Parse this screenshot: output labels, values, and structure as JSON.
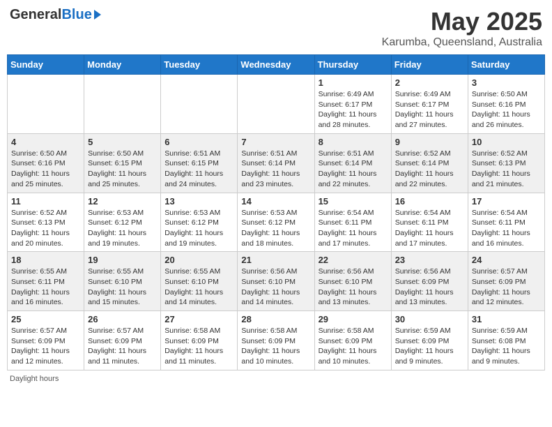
{
  "logo": {
    "general": "General",
    "blue": "Blue"
  },
  "title": "May 2025",
  "location": "Karumba, Queensland, Australia",
  "days_of_week": [
    "Sunday",
    "Monday",
    "Tuesday",
    "Wednesday",
    "Thursday",
    "Friday",
    "Saturday"
  ],
  "weeks": [
    [
      {
        "day": "",
        "info": ""
      },
      {
        "day": "",
        "info": ""
      },
      {
        "day": "",
        "info": ""
      },
      {
        "day": "",
        "info": ""
      },
      {
        "day": "1",
        "info": "Sunrise: 6:49 AM\nSunset: 6:17 PM\nDaylight: 11 hours and 28 minutes."
      },
      {
        "day": "2",
        "info": "Sunrise: 6:49 AM\nSunset: 6:17 PM\nDaylight: 11 hours and 27 minutes."
      },
      {
        "day": "3",
        "info": "Sunrise: 6:50 AM\nSunset: 6:16 PM\nDaylight: 11 hours and 26 minutes."
      }
    ],
    [
      {
        "day": "4",
        "info": "Sunrise: 6:50 AM\nSunset: 6:16 PM\nDaylight: 11 hours and 25 minutes."
      },
      {
        "day": "5",
        "info": "Sunrise: 6:50 AM\nSunset: 6:15 PM\nDaylight: 11 hours and 25 minutes."
      },
      {
        "day": "6",
        "info": "Sunrise: 6:51 AM\nSunset: 6:15 PM\nDaylight: 11 hours and 24 minutes."
      },
      {
        "day": "7",
        "info": "Sunrise: 6:51 AM\nSunset: 6:14 PM\nDaylight: 11 hours and 23 minutes."
      },
      {
        "day": "8",
        "info": "Sunrise: 6:51 AM\nSunset: 6:14 PM\nDaylight: 11 hours and 22 minutes."
      },
      {
        "day": "9",
        "info": "Sunrise: 6:52 AM\nSunset: 6:14 PM\nDaylight: 11 hours and 22 minutes."
      },
      {
        "day": "10",
        "info": "Sunrise: 6:52 AM\nSunset: 6:13 PM\nDaylight: 11 hours and 21 minutes."
      }
    ],
    [
      {
        "day": "11",
        "info": "Sunrise: 6:52 AM\nSunset: 6:13 PM\nDaylight: 11 hours and 20 minutes."
      },
      {
        "day": "12",
        "info": "Sunrise: 6:53 AM\nSunset: 6:12 PM\nDaylight: 11 hours and 19 minutes."
      },
      {
        "day": "13",
        "info": "Sunrise: 6:53 AM\nSunset: 6:12 PM\nDaylight: 11 hours and 19 minutes."
      },
      {
        "day": "14",
        "info": "Sunrise: 6:53 AM\nSunset: 6:12 PM\nDaylight: 11 hours and 18 minutes."
      },
      {
        "day": "15",
        "info": "Sunrise: 6:54 AM\nSunset: 6:11 PM\nDaylight: 11 hours and 17 minutes."
      },
      {
        "day": "16",
        "info": "Sunrise: 6:54 AM\nSunset: 6:11 PM\nDaylight: 11 hours and 17 minutes."
      },
      {
        "day": "17",
        "info": "Sunrise: 6:54 AM\nSunset: 6:11 PM\nDaylight: 11 hours and 16 minutes."
      }
    ],
    [
      {
        "day": "18",
        "info": "Sunrise: 6:55 AM\nSunset: 6:11 PM\nDaylight: 11 hours and 16 minutes."
      },
      {
        "day": "19",
        "info": "Sunrise: 6:55 AM\nSunset: 6:10 PM\nDaylight: 11 hours and 15 minutes."
      },
      {
        "day": "20",
        "info": "Sunrise: 6:55 AM\nSunset: 6:10 PM\nDaylight: 11 hours and 14 minutes."
      },
      {
        "day": "21",
        "info": "Sunrise: 6:56 AM\nSunset: 6:10 PM\nDaylight: 11 hours and 14 minutes."
      },
      {
        "day": "22",
        "info": "Sunrise: 6:56 AM\nSunset: 6:10 PM\nDaylight: 11 hours and 13 minutes."
      },
      {
        "day": "23",
        "info": "Sunrise: 6:56 AM\nSunset: 6:09 PM\nDaylight: 11 hours and 13 minutes."
      },
      {
        "day": "24",
        "info": "Sunrise: 6:57 AM\nSunset: 6:09 PM\nDaylight: 11 hours and 12 minutes."
      }
    ],
    [
      {
        "day": "25",
        "info": "Sunrise: 6:57 AM\nSunset: 6:09 PM\nDaylight: 11 hours and 12 minutes."
      },
      {
        "day": "26",
        "info": "Sunrise: 6:57 AM\nSunset: 6:09 PM\nDaylight: 11 hours and 11 minutes."
      },
      {
        "day": "27",
        "info": "Sunrise: 6:58 AM\nSunset: 6:09 PM\nDaylight: 11 hours and 11 minutes."
      },
      {
        "day": "28",
        "info": "Sunrise: 6:58 AM\nSunset: 6:09 PM\nDaylight: 11 hours and 10 minutes."
      },
      {
        "day": "29",
        "info": "Sunrise: 6:58 AM\nSunset: 6:09 PM\nDaylight: 11 hours and 10 minutes."
      },
      {
        "day": "30",
        "info": "Sunrise: 6:59 AM\nSunset: 6:09 PM\nDaylight: 11 hours and 9 minutes."
      },
      {
        "day": "31",
        "info": "Sunrise: 6:59 AM\nSunset: 6:08 PM\nDaylight: 11 hours and 9 minutes."
      }
    ]
  ],
  "footnote": "Daylight hours"
}
